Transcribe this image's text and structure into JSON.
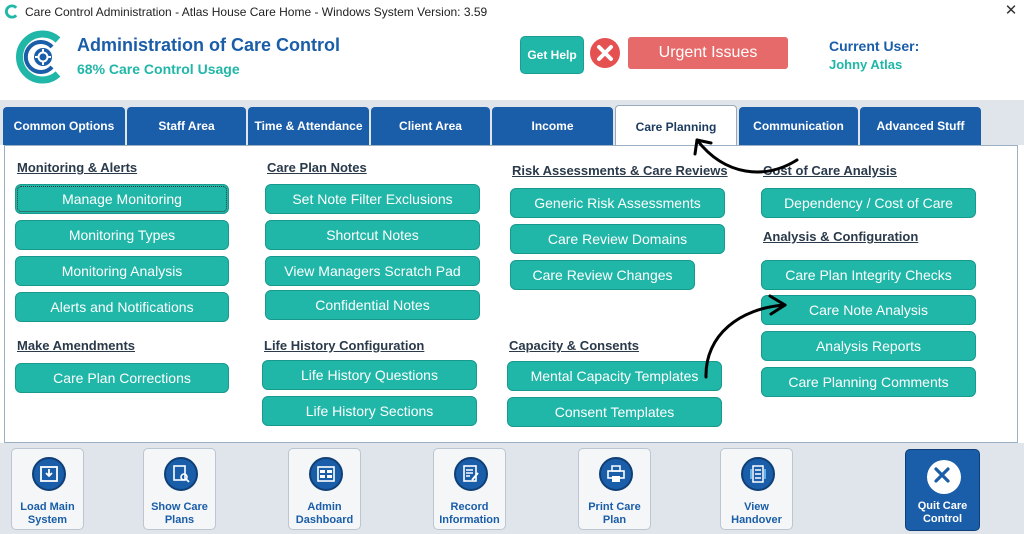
{
  "window": {
    "title": "Care Control Administration - Atlas House Care Home - Windows System Version: 3.59",
    "close_glyph": "✕"
  },
  "header": {
    "heading": "Administration of Care Control",
    "usage": "68% Care Control Usage",
    "help_label": "Get Help",
    "urgent_label": "Urgent Issues",
    "user_label": "Current User:",
    "user_name": "Johny Atlas"
  },
  "tabs": [
    {
      "label": "Common Options",
      "active": false
    },
    {
      "label": "Staff Area",
      "active": false
    },
    {
      "label": "Time & Attendance",
      "active": false
    },
    {
      "label": "Client Area",
      "active": false
    },
    {
      "label": "Income",
      "active": false
    },
    {
      "label": "Care Planning",
      "active": true
    },
    {
      "label": "Communication",
      "active": false
    },
    {
      "label": "Advanced Stuff",
      "active": false
    }
  ],
  "sections": {
    "monitoring": {
      "title": "Monitoring & Alerts",
      "items": [
        "Manage Monitoring",
        "Monitoring Types",
        "Monitoring Analysis",
        "Alerts and Notifications"
      ]
    },
    "amendments": {
      "title": "Make Amendments",
      "items": [
        "Care Plan Corrections"
      ]
    },
    "notes": {
      "title": "Care Plan Notes",
      "items": [
        "Set Note Filter Exclusions",
        "Shortcut Notes",
        "View Managers Scratch Pad",
        "Confidential Notes"
      ]
    },
    "life_history": {
      "title": "Life History Configuration",
      "items": [
        "Life History Questions",
        "Life History Sections"
      ]
    },
    "risk": {
      "title": "Risk Assessments & Care Reviews",
      "items": [
        "Generic Risk Assessments",
        "Care Review Domains",
        "Care Review Changes"
      ]
    },
    "capacity": {
      "title": "Capacity & Consents",
      "items": [
        "Mental Capacity Templates",
        "Consent Templates"
      ]
    },
    "cost": {
      "title": "Cost of Care Analysis",
      "items": [
        "Dependency / Cost of Care"
      ]
    },
    "analysis": {
      "title": "Analysis & Configuration",
      "items": [
        "Care Plan Integrity Checks",
        "Care Note Analysis",
        "Analysis Reports",
        "Care Planning Comments"
      ]
    }
  },
  "toolbar": [
    {
      "line1": "Load Main",
      "line2": "System",
      "icon": "download-icon"
    },
    {
      "line1": "Show Care",
      "line2": "Plans",
      "icon": "document-search-icon"
    },
    {
      "line1": "Admin",
      "line2": "Dashboard",
      "icon": "dashboard-icon"
    },
    {
      "line1": "Record",
      "line2": "Information",
      "icon": "edit-document-icon"
    },
    {
      "line1": "Print Care",
      "line2": "Plan",
      "icon": "printer-icon"
    },
    {
      "line1": "View",
      "line2": "Handover",
      "icon": "handover-list-icon"
    },
    {
      "line1": "Quit Care",
      "line2": "Control",
      "icon": "close-icon"
    }
  ],
  "colors": {
    "brand_blue": "#1a5da8",
    "teal": "#20b7a8",
    "urgent_red": "#e66a6a"
  }
}
